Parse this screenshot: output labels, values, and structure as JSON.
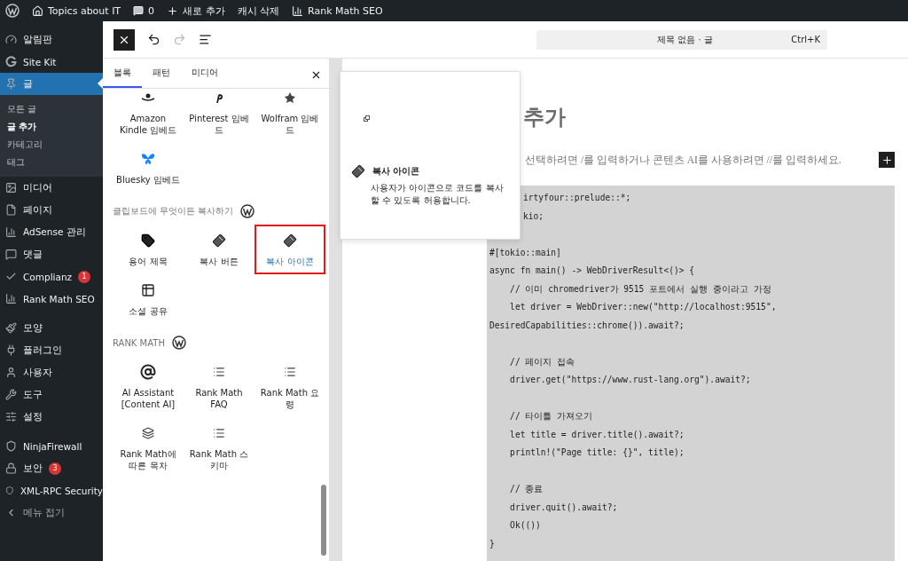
{
  "admin_bar": {
    "site": "Topics about IT",
    "comments": "0",
    "new": "새로 추가",
    "cache": "캐시 삭제",
    "seo": "Rank Math SEO"
  },
  "sidebar": {
    "items": [
      {
        "label": "알림판",
        "selected": false
      },
      {
        "label": "Site Kit",
        "selected": false
      },
      {
        "label": "글",
        "selected": true,
        "children": [
          {
            "label": "모든 글",
            "selected": false
          },
          {
            "label": "글 추가",
            "selected": true
          },
          {
            "label": "카테고리",
            "selected": false
          },
          {
            "label": "태그",
            "selected": false
          }
        ]
      },
      {
        "label": "미디어",
        "selected": false
      },
      {
        "label": "페이지",
        "selected": false
      },
      {
        "label": "AdSense 관리",
        "selected": false
      },
      {
        "label": "댓글",
        "selected": false
      },
      {
        "label": "Complianz",
        "selected": false,
        "badge": "1"
      },
      {
        "label": "Rank Math SEO",
        "selected": false
      },
      {
        "label": "모양",
        "selected": false
      },
      {
        "label": "플러그인",
        "selected": false
      },
      {
        "label": "사용자",
        "selected": false
      },
      {
        "label": "도구",
        "selected": false
      },
      {
        "label": "설정",
        "selected": false
      },
      {
        "label": "NinjaFirewall",
        "selected": false
      },
      {
        "label": "보안",
        "selected": false,
        "badge": "3"
      },
      {
        "label": "XML-RPC Security",
        "selected": false
      },
      {
        "label": "메뉴 접기",
        "selected": false
      }
    ]
  },
  "toolbar": {
    "redo_disabled": true,
    "command": "제목 없음 · 글",
    "shortcut": "Ctrl+K"
  },
  "inserter": {
    "tabs": [
      {
        "label": "블록",
        "selected": true
      },
      {
        "label": "패턴",
        "selected": false
      },
      {
        "label": "미디어",
        "selected": false
      }
    ],
    "sections": [
      {
        "blocks": [
          {
            "label": "Amazon Kindle 임베드",
            "selected": false
          },
          {
            "label": "Pinterest 임베드",
            "selected": false
          },
          {
            "label": "Wolfram 임베드",
            "selected": false
          },
          {
            "label": "Bluesky 임베드",
            "selected": false
          }
        ]
      },
      {
        "title": "클립보드에 무엇이든 복사하기",
        "blocks": [
          {
            "label": "용어 제목",
            "selected": false
          },
          {
            "label": "복사 버튼",
            "selected": false
          },
          {
            "label": "복사 아이콘",
            "selected": true
          },
          {
            "label": "소셜 공유",
            "selected": false
          }
        ]
      },
      {
        "title": "RANK MATH",
        "blocks": [
          {
            "label": "AI Assistant [Content AI]",
            "selected": false
          },
          {
            "label": "Rank Math FAQ",
            "selected": false
          },
          {
            "label": "Rank Math 요령",
            "selected": false
          },
          {
            "label": "Rank Math에 따른 목차",
            "selected": false
          },
          {
            "label": "Rank Math 스키마",
            "selected": false
          }
        ]
      }
    ]
  },
  "preview": {
    "title": "복사 아이콘",
    "description": "사용자가 아이콘으로 코드를 복사할 수 있도록 허용합니다."
  },
  "canvas": {
    "title": "추가",
    "placeholder": "선택하려면 /를 입력하거나 콘텐츠 AI를 사용하려면 //를 입력하세요.",
    "code": [
      [
        "irtyfour::prelude::*;",
        "kio;"
      ],
      [
        "#[tokio::main]",
        "async fn main() -> WebDriverResult<()> {",
        "    // 이미 chromedriver가 9515 포트에서 실행 중이라고 가정",
        "    let driver = WebDriver::new(\"http://localhost:9515\",",
        "DesiredCapabilities::chrome()).await?;"
      ],
      [
        "    // 페이지 접속",
        "    driver.get(\"https://www.rust-lang.org\").await?;"
      ],
      [
        "    // 타이틀 가져오기",
        "    let title = driver.title().await?;",
        "    println!(\"Page title: {}\", title);"
      ],
      [
        "    // 종료",
        "    driver.quit().await?;",
        "    Ok(())",
        "}"
      ]
    ]
  }
}
